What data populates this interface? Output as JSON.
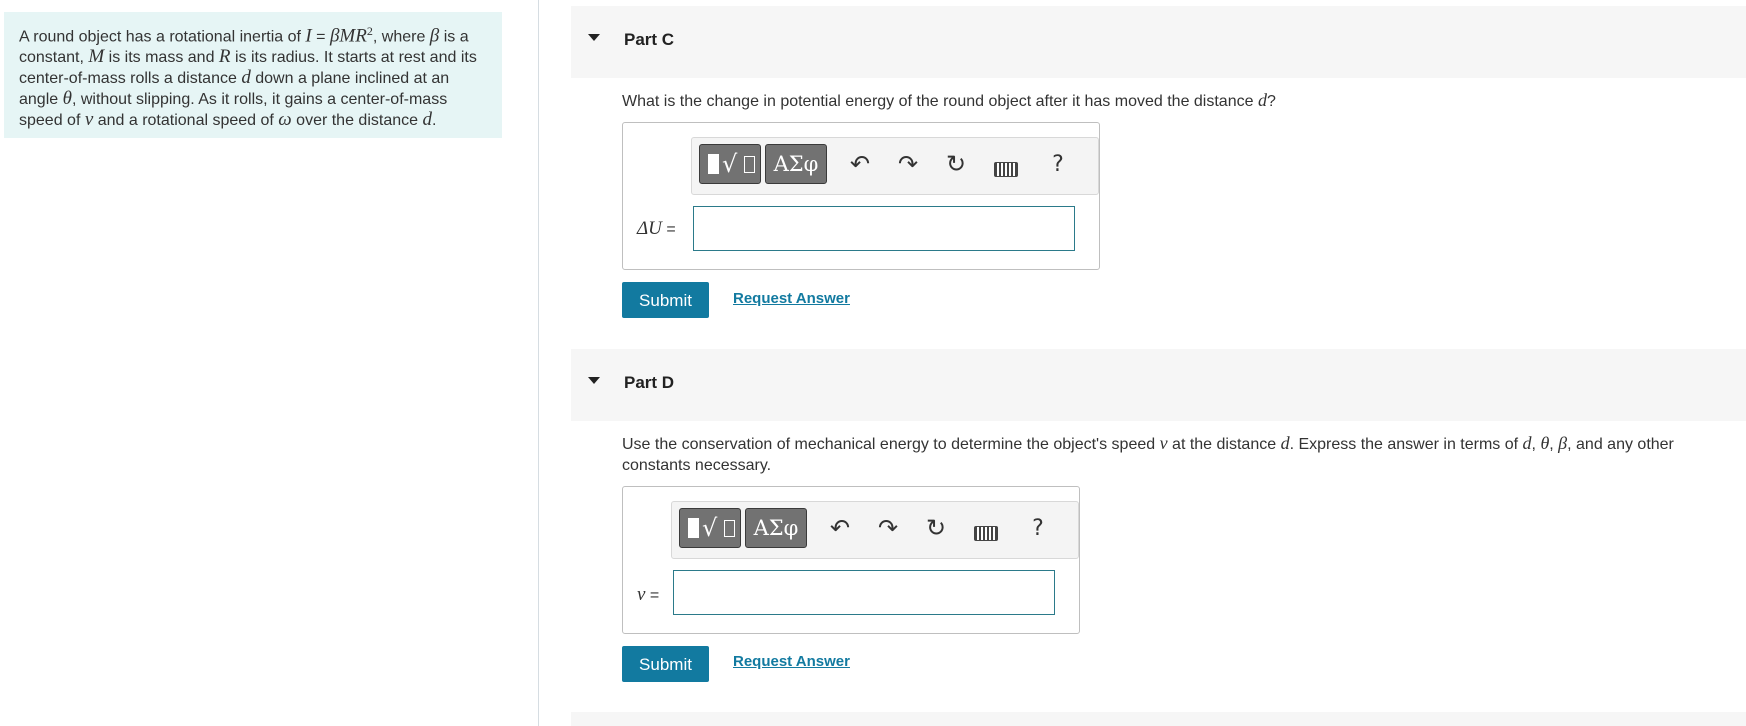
{
  "problem": {
    "segments": [
      "A round object has a rotational inertia of ",
      "I",
      " = ",
      "βMR",
      "2",
      ", where ",
      "β",
      " is a constant, ",
      "M",
      " is its mass and ",
      "R",
      " is its radius. It starts at rest and its center-of-mass rolls a distance ",
      "d",
      " down a plane inclined at an angle ",
      "θ",
      ", without slipping. As it rolls, it gains a center-of-mass speed of ",
      "v",
      " and a rotational speed of ",
      "ω",
      " over the distance ",
      "d",
      "."
    ]
  },
  "part_c": {
    "title": "Part C",
    "question_text": "What is the change in potential energy of the round object after it has moved the distance ",
    "question_var": "d",
    "question_end": "?",
    "label_var": "ΔU",
    "label_eq": " =",
    "input_value": "",
    "submit_label": "Submit",
    "request_label": "Request Answer"
  },
  "part_d": {
    "title": "Part D",
    "q_1": "Use the conservation of mechanical energy to determine the object's speed ",
    "q_v": "v",
    "q_2": " at the distance ",
    "q_d": "d",
    "q_3": ". Express the answer in terms of ",
    "q_d2": "d",
    "q_4": ", ",
    "q_theta": "θ",
    "q_5": ", ",
    "q_beta": "β",
    "q_6": ", and any other constants necessary.",
    "label_var": "v",
    "label_eq": " =",
    "input_value": "",
    "submit_label": "Submit",
    "request_label": "Request Answer"
  },
  "toolbar": {
    "greek_label": "ΑΣφ",
    "undo_glyph": "↶",
    "redo_glyph": "↷",
    "reset_glyph": "↻",
    "help_label": "?",
    "icons": [
      "templates-icon",
      "greek-letters-icon",
      "undo-icon",
      "redo-icon",
      "reset-icon",
      "keyboard-icon",
      "help-icon"
    ]
  },
  "colors": {
    "accent": "#127aa0",
    "problem_bg": "#e6f5f5",
    "header_bg": "#f6f6f6",
    "input_border": "#2b7a8a"
  }
}
